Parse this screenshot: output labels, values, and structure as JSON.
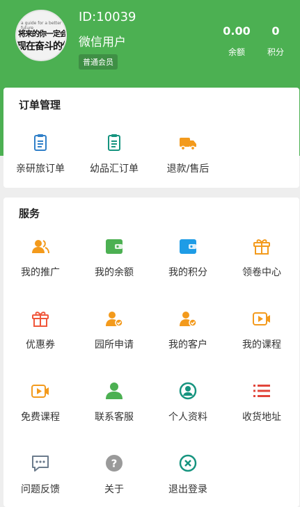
{
  "user": {
    "id": "ID:10039",
    "name": "微信用户",
    "level": "普通会员",
    "avatar_text": [
      "a guide for a better future",
      "将来的你一定会感谢",
      "现在奋斗的你"
    ]
  },
  "stats": [
    {
      "value": "0.00",
      "label": "余额"
    },
    {
      "value": "0",
      "label": "积分"
    }
  ],
  "orders": {
    "title": "订单管理",
    "items": [
      {
        "label": "亲研旅订单",
        "icon": "clipboard-icon",
        "color": "#2f7fc8"
      },
      {
        "label": "幼品汇订单",
        "icon": "clipboard-icon",
        "color": "#16947f"
      },
      {
        "label": "退款/售后",
        "icon": "truck-icon",
        "color": "#f39a1c"
      }
    ]
  },
  "services": {
    "title": "服务",
    "items": [
      {
        "label": "我的推广",
        "icon": "users-icon",
        "color": "#f39a1c"
      },
      {
        "label": "我的余额",
        "icon": "wallet-icon",
        "color": "#4cb052"
      },
      {
        "label": "我的积分",
        "icon": "wallet-icon",
        "color": "#1e9ce6"
      },
      {
        "label": "领卷中心",
        "icon": "gift-icon",
        "color": "#f39a1c"
      },
      {
        "label": "优惠券",
        "icon": "gift-icon",
        "color": "#f0563a"
      },
      {
        "label": "园所申请",
        "icon": "user-check-icon",
        "color": "#f39a1c"
      },
      {
        "label": "我的客户",
        "icon": "user-check-icon",
        "color": "#f39a1c"
      },
      {
        "label": "我的课程",
        "icon": "video-icon",
        "color": "#f39a1c"
      },
      {
        "label": "免费课程",
        "icon": "video-icon",
        "color": "#f39a1c"
      },
      {
        "label": "联系客服",
        "icon": "person-icon",
        "color": "#4cb052"
      },
      {
        "label": "个人资料",
        "icon": "profile-circle-icon",
        "color": "#16947f"
      },
      {
        "label": "收货地址",
        "icon": "list-icon",
        "color": "#e2453a"
      },
      {
        "label": "问题反馈",
        "icon": "chat-icon",
        "color": "#6b7b8c"
      },
      {
        "label": "关于",
        "icon": "help-icon",
        "color": "#9a9a9a"
      },
      {
        "label": "退出登录",
        "icon": "close-circle-icon",
        "color": "#16947f"
      }
    ]
  }
}
